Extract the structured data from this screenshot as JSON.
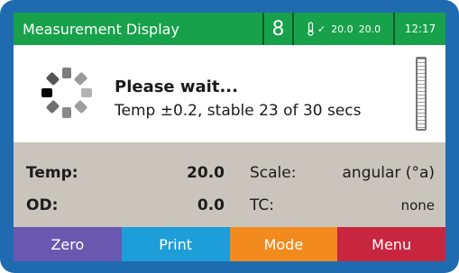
{
  "header": {
    "title": "Measurement Display",
    "channel": "8",
    "temp_check_icon": "thermometer-check-icon",
    "temp_check_mark": "✓",
    "temp_a": "20.0",
    "temp_b": "20.0",
    "time": "12:17"
  },
  "message": {
    "title": "Please wait...",
    "detail": "Temp ±0.2, stable 23 of 30 secs",
    "spinner_icon": "loading-spinner-icon"
  },
  "readings": {
    "temp_label": "Temp:",
    "temp_value": "20.0",
    "od_label": "OD:",
    "od_value": "0.0",
    "scale_label": "Scale:",
    "scale_value": "angular (°a)",
    "tc_label": "TC:",
    "tc_value": "none"
  },
  "softkeys": {
    "zero": "Zero",
    "print": "Print",
    "mode": "Mode",
    "menu": "Menu"
  },
  "colors": {
    "frame": "#1f6bb0",
    "header_green": "#17a14a",
    "readings_bg": "#c9c5bd",
    "zero": "#6a57b0",
    "print": "#1e9ed8",
    "mode": "#f28a1e",
    "menu": "#c8263f"
  }
}
